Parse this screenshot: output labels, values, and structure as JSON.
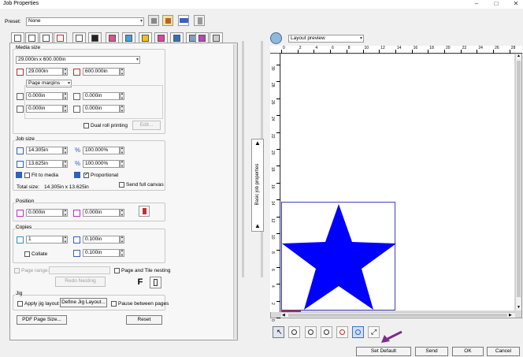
{
  "window": {
    "title": "Job Properties"
  },
  "preset": {
    "label": "Preset:",
    "value": "None"
  },
  "media_size": {
    "label": "Media size",
    "size_value": "29.000in x 600.000in",
    "width": "29.000in",
    "height": "600.000in",
    "margins_mode": "Page margins",
    "margin_top_left": "0.000in",
    "margin_top_right": "0.000in",
    "margin_bottom_left": "0.000in",
    "margin_bottom_right": "0.000in",
    "dual_roll_label": "Dual roll printing",
    "edit_label": "Edit..."
  },
  "job_size": {
    "label": "Job size",
    "width": "14.305in",
    "width_pct": "100.000%",
    "height": "13.625in",
    "height_pct": "100.000%",
    "fit_label": "Fit to media",
    "proportional_label": "Proportional",
    "send_full_label": "Send full canvas",
    "total_label": "Total size:",
    "total_value": "14.305in x 13.625in"
  },
  "position": {
    "label": "Position",
    "x": "0.000in",
    "y": "0.000in"
  },
  "copies": {
    "label": "Copies",
    "count": "1",
    "spacing_h": "0.100in",
    "spacing_v": "0.100in",
    "collate_label": "Collate"
  },
  "nesting": {
    "page_range_label": "Page range:",
    "page_tile_label": "Page and Tile nesting",
    "redo_label": "Redo Nesting",
    "f_label": "F"
  },
  "jig": {
    "label": "Jig",
    "apply_label": "Apply jig layout",
    "define_label": "Define Jig Layout...",
    "pause_label": "Pause between pages"
  },
  "bottom_buttons": {
    "pdf_label": "PDF Page Size...",
    "reset_label": "Reset"
  },
  "side_tab": {
    "label": "Basic job properties"
  },
  "preview": {
    "mode": "Layout preview",
    "h_ruler_labels": [
      "0",
      "2",
      "4",
      "6",
      "8",
      "10",
      "12",
      "14",
      "16",
      "18",
      "20",
      "22",
      "24",
      "26",
      "28"
    ],
    "v_ruler_labels": [
      "30",
      "28",
      "26",
      "24",
      "22",
      "20",
      "18",
      "16",
      "14",
      "12",
      "10",
      "8",
      "6",
      "4",
      "2",
      "0"
    ],
    "star_color": "#0000ff"
  },
  "footer": {
    "set_default_label": "Set Default",
    "send_label": "Send",
    "ok_label": "OK",
    "cancel_label": "Cancel"
  },
  "icons": {
    "tabs": [
      "page-icon",
      "printer-icon",
      "output-icon",
      "grid-icon",
      "gear-icon",
      "layers-icon",
      "stack-icon",
      "color-icon",
      "color-icon",
      "chart-icon",
      "sheet-icon",
      "pen-icon",
      "wrench-icon"
    ],
    "toolbar": [
      "select-icon",
      "zoom-icon",
      "zoom-in-icon",
      "zoom-out-icon",
      "zoom-fit-icon",
      "zoom-page-icon",
      "fullscreen-icon"
    ],
    "annotation_arrow_color": "#7b2d8b"
  }
}
